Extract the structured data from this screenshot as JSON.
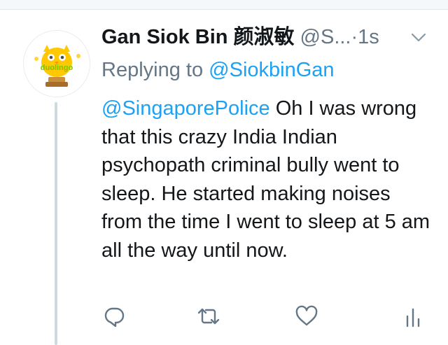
{
  "author": {
    "display_name": "Gan Siok Bin 颜淑敏",
    "handle": "@S...",
    "separator": "·",
    "timestamp": "1s",
    "avatar_label": "duolingo"
  },
  "replying": {
    "prefix": "Replying to",
    "handle": "@SiokbinGan"
  },
  "tweet": {
    "mention": "@SingaporePolice",
    "text": "Oh I was wrong that this crazy India Indian psychopath criminal bully went to sleep. He started making noises from the time I went to sleep at 5 am all the way until now."
  },
  "icons": {
    "menu": "chevron-down-icon",
    "reply": "reply-icon",
    "retweet": "retweet-icon",
    "like": "heart-icon",
    "analytics": "analytics-icon"
  },
  "colors": {
    "link": "#1da1f2",
    "secondary": "#657786",
    "primary_text": "#14171a",
    "duolingo_green": "#78c800"
  }
}
